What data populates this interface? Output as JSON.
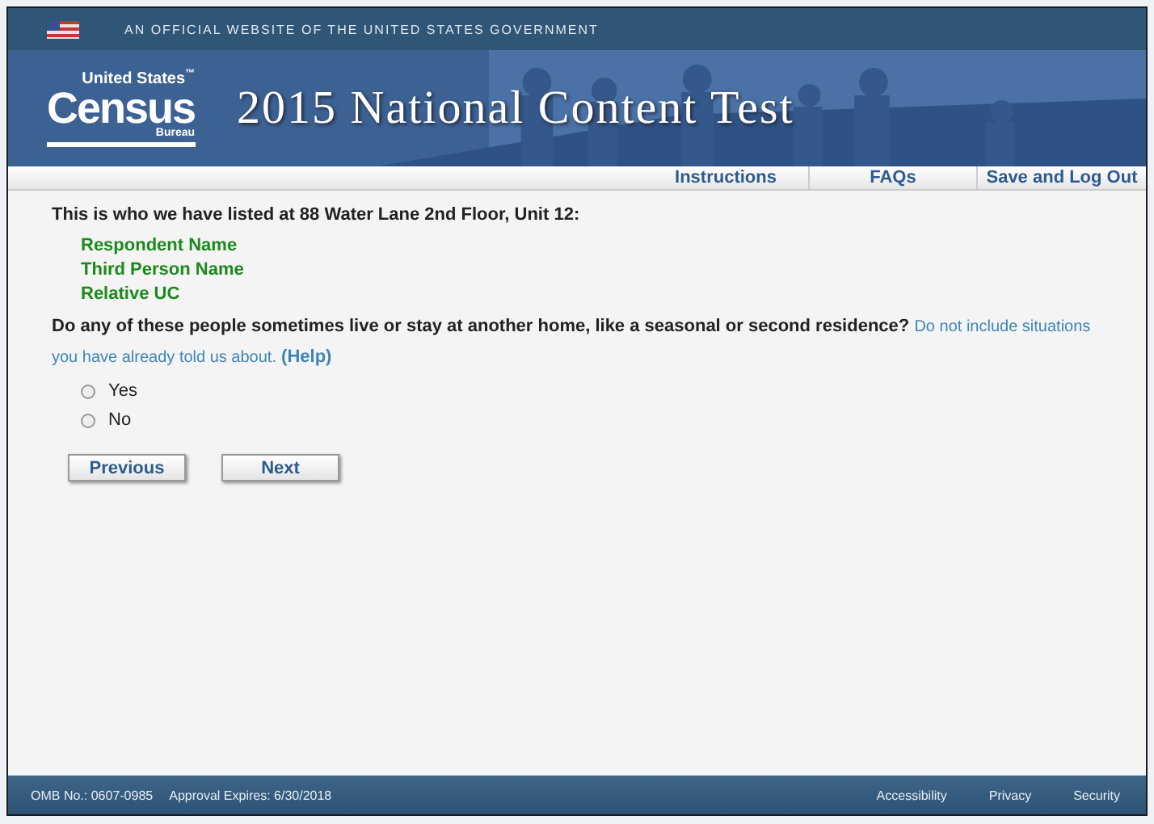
{
  "gov_banner": {
    "text": "AN OFFICIAL WEBSITE OF THE UNITED STATES GOVERNMENT"
  },
  "logo": {
    "top": "United States",
    "tm": "™",
    "main": "Census",
    "bottom": "Bureau"
  },
  "header": {
    "title": "2015 National Content Test"
  },
  "nav": [
    "Instructions",
    "FAQs",
    "Save and Log Out"
  ],
  "intro": "This is who we have listed at 88 Water Lane 2nd Floor, Unit 12:",
  "people": [
    "Respondent Name",
    "Third Person Name",
    "Relative UC"
  ],
  "question": {
    "text": "Do any of these people sometimes live or stay at another home, like a seasonal or second residence?",
    "note": "Do not include situations you have already told us about.",
    "help": "(Help)"
  },
  "options": [
    {
      "label": "Yes",
      "selected": false
    },
    {
      "label": "No",
      "selected": false
    }
  ],
  "buttons": [
    "Previous",
    "Next"
  ],
  "footer": {
    "left": [
      "OMB No.: 0607-0985",
      "Approval Expires: 6/30/2018"
    ],
    "links": [
      "Accessibility",
      "Privacy",
      "Security"
    ]
  }
}
